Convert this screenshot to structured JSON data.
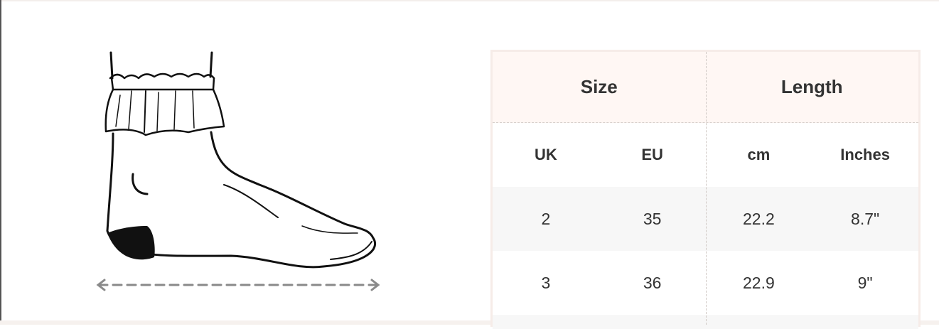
{
  "size_chart": {
    "header": {
      "size": "Size",
      "length": "Length"
    },
    "columns": {
      "uk": "UK",
      "eu": "EU",
      "cm": "cm",
      "inches": "Inches"
    },
    "rows": [
      {
        "uk": "2",
        "eu": "35",
        "cm": "22.2",
        "inches": "8.7\""
      },
      {
        "uk": "3",
        "eu": "36",
        "cm": "22.9",
        "inches": "9\""
      }
    ]
  },
  "colors": {
    "header_bg": "#fff7f4",
    "zebra_bg": "#f7f7f7",
    "border": "#f6ece8",
    "text": "#333333"
  },
  "illustration": {
    "icon": "sock-outline-icon",
    "measure_arrow": "length-arrow-icon"
  }
}
